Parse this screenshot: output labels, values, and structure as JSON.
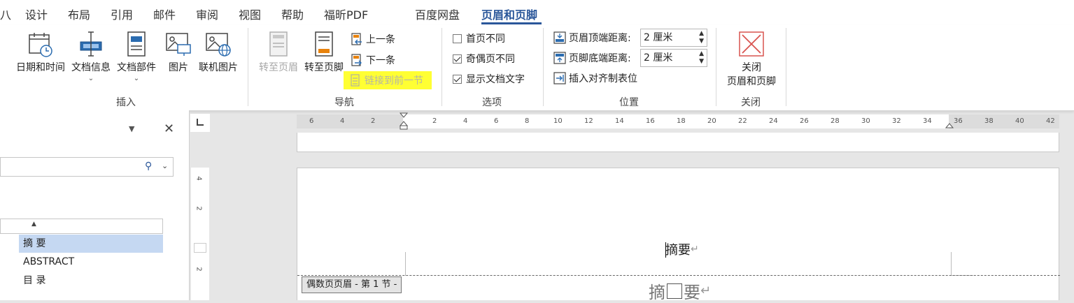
{
  "tabs": [
    {
      "label": "八"
    },
    {
      "label": "设计"
    },
    {
      "label": "布局"
    },
    {
      "label": "引用"
    },
    {
      "label": "邮件"
    },
    {
      "label": "审阅"
    },
    {
      "label": "视图"
    },
    {
      "label": "帮助"
    },
    {
      "label": "福昕PDF"
    },
    {
      "label": "百度网盘"
    },
    {
      "label": "页眉和页脚"
    }
  ],
  "ribbon": {
    "insert": {
      "group_label": "插入",
      "date_time": "日期和时间",
      "doc_info": "文档信息",
      "doc_parts": "文档部件",
      "picture": "图片",
      "online_picture": "联机图片",
      "chevron": "⌄"
    },
    "navigation": {
      "group_label": "导航",
      "goto_header": "转至页眉",
      "goto_footer": "转至页脚",
      "previous": "上一条",
      "next": "下一条",
      "link_to_previous": "链接到前一节"
    },
    "options": {
      "group_label": "选项",
      "different_first": "首页不同",
      "different_odd_even": "奇偶页不同",
      "show_doc_text": "显示文档文字"
    },
    "position": {
      "group_label": "位置",
      "header_from_top": "页眉顶端距离:",
      "header_from_top_value": "2 厘米",
      "footer_from_bottom": "页脚底端距离:",
      "footer_from_bottom_value": "2 厘米",
      "insert_align_tab": "插入对齐制表位"
    },
    "close": {
      "group_label": "关闭",
      "close_line1": "关闭",
      "close_line2": "页眉和页脚"
    }
  },
  "nav_pane": {
    "items": [
      {
        "label": "摘 要"
      },
      {
        "label": "ABSTRACT"
      },
      {
        "label": "目 录"
      }
    ]
  },
  "ruler": {
    "h_left": [
      "6",
      "4",
      "2"
    ],
    "h_right": [
      "2",
      "4",
      "6",
      "8",
      "10",
      "12",
      "14",
      "16",
      "18",
      "20",
      "22",
      "24",
      "26",
      "28",
      "30",
      "32",
      "34",
      "36",
      "38",
      "40",
      "42"
    ],
    "v": [
      "4",
      "2",
      "2"
    ]
  },
  "document": {
    "header_text": "摘要",
    "header_tag": "偶数页页眉 - 第 1 节 -",
    "body_text_a": "摘",
    "body_text_b": "要"
  },
  "colors": {
    "accent": "#2b579a",
    "highlight": "#ffff33",
    "selection": "#c5d8f2"
  }
}
